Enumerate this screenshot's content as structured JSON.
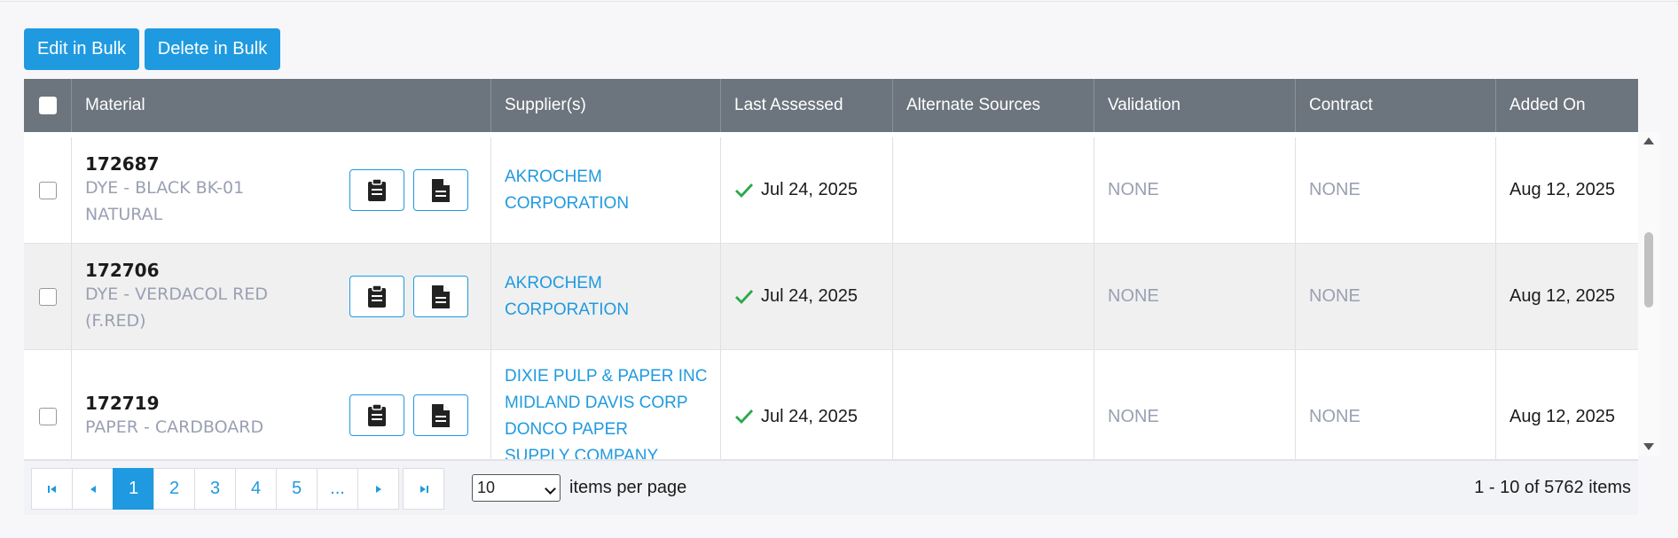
{
  "toolbar": {
    "edit_bulk_label": "Edit in Bulk",
    "delete_bulk_label": "Delete in Bulk"
  },
  "columns": {
    "material": "Material",
    "suppliers": "Supplier(s)",
    "last_assessed": "Last Assessed",
    "alternate_sources": "Alternate Sources",
    "validation": "Validation",
    "contract": "Contract",
    "added_on": "Added On"
  },
  "rows": [
    {
      "id": "172687",
      "description": "DYE - BLACK BK-01 NATURAL",
      "suppliers": [
        "AKROCHEM CORPORATION"
      ],
      "last_assessed": "Jul 24, 2025",
      "alternate_sources": "",
      "validation": "NONE",
      "contract": "NONE",
      "added_on": "Aug 12, 2025"
    },
    {
      "id": "172706",
      "description": "DYE - VERDACOL RED (F.RED)",
      "suppliers": [
        "AKROCHEM CORPORATION"
      ],
      "last_assessed": "Jul 24, 2025",
      "alternate_sources": "",
      "validation": "NONE",
      "contract": "NONE",
      "added_on": "Aug 12, 2025"
    },
    {
      "id": "172719",
      "description": "PAPER - CARDBOARD",
      "suppliers": [
        "DIXIE PULP & PAPER INC",
        "MIDLAND DAVIS CORP",
        "DONCO PAPER SUPPLY COMPANY"
      ],
      "last_assessed": "Jul 24, 2025",
      "alternate_sources": "",
      "validation": "NONE",
      "contract": "NONE",
      "added_on": "Aug 12, 2025"
    }
  ],
  "pagination": {
    "pages": [
      "1",
      "2",
      "3",
      "4",
      "5",
      "..."
    ],
    "current_page": "1",
    "page_size": "10",
    "page_size_label": "items per page",
    "summary": "1 - 10 of 5762 items"
  },
  "icons": {
    "row_action_1": "clipboard-icon",
    "row_action_2": "document-icon",
    "assessed": "checkmark-icon"
  },
  "colors": {
    "accent": "#1f9ae0",
    "header_bg": "#6c757d",
    "check_green": "#2aa84a",
    "muted_text": "#9aa0b3"
  }
}
